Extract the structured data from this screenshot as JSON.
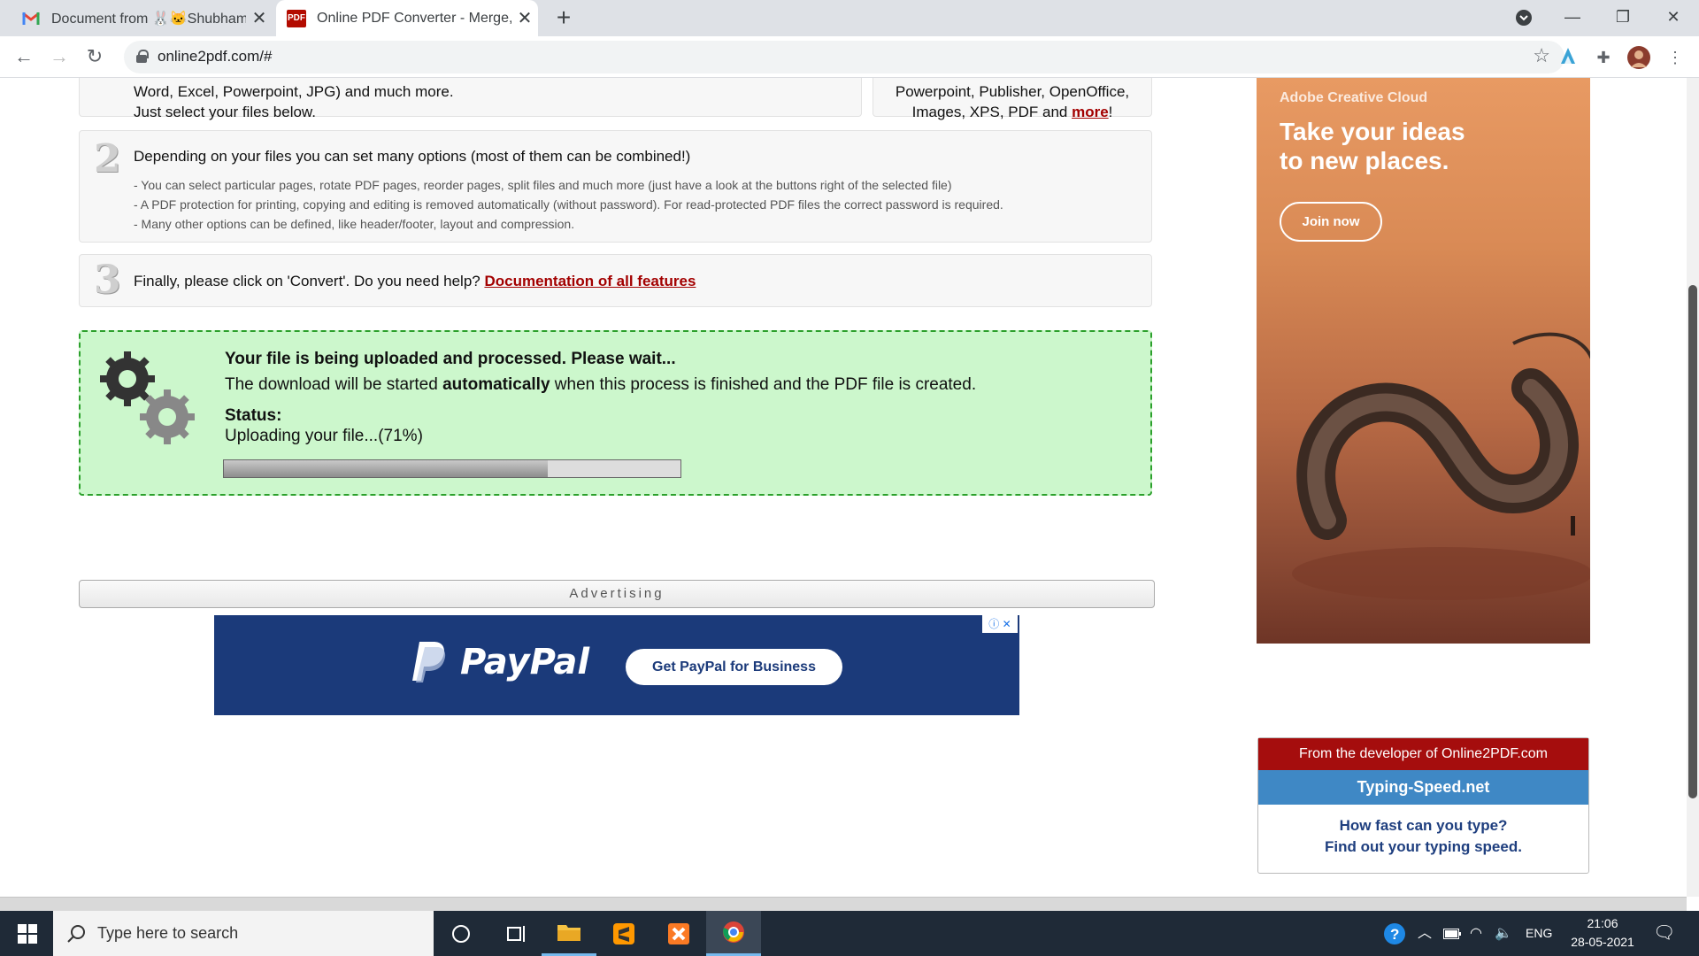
{
  "browser": {
    "tabs": [
      {
        "title": "Document from 🐰🐱Shubham🎸",
        "favicon": "gmail-icon",
        "active": false
      },
      {
        "title": "Online PDF Converter - Merge, compress",
        "favicon": "pdf-icon",
        "favicon_text": "PDF",
        "active": true
      }
    ],
    "new_tab": "+",
    "url": "online2pdf.com/#"
  },
  "steps": {
    "step1_left_line1": "Word, Excel, Powerpoint, JPG) and much more.",
    "step1_left_line2": "Just select your files below.",
    "step1_right_line1": "Powerpoint, Publisher, OpenOffice,",
    "step1_right_line2_prefix": "Images, XPS, PDF and ",
    "step1_right_link": "more",
    "step1_right_suffix": "!",
    "step2_num": "2",
    "step2_title": "Depending on your files you can set many options (most of them can be combined!)",
    "step2_bullets": [
      "- You can select particular pages, rotate PDF pages, reorder pages, split files and much more (just have a look at the buttons right of the selected file)",
      "- A PDF protection for printing, copying and editing is removed automatically (without password). For read-protected PDF files the correct password is required.",
      "- Many other options can be defined, like header/footer, layout and compression."
    ],
    "step3_num": "3",
    "step3_text": "Finally, please click on 'Convert'. Do you need help? ",
    "step3_link": "Documentation of all features"
  },
  "upload": {
    "headline": "Your file is being uploaded and processed. Please wait...",
    "desc_prefix": "The download will be started ",
    "desc_bold": "automatically",
    "desc_suffix": " when this process is finished and the PDF file is created.",
    "status_label": "Status:",
    "status_text": "Uploading your file...(71%)",
    "progress_fraction": 0.71
  },
  "ads": {
    "advertising_label": "Advertising",
    "paypal_logo": "PayPal",
    "paypal_cta": "Get PayPal for Business",
    "adobe_brand": "Adobe Creative Cloud",
    "adobe_head_line1": "Take your ideas",
    "adobe_head_line2": "to new places.",
    "adobe_cta": "Join now"
  },
  "developer": {
    "header": "From the developer of Online2PDF.com",
    "site": "Typing-Speed.net",
    "line1": "How fast can you type?",
    "line2": "Find out your typing speed."
  },
  "taskbar": {
    "search_placeholder": "Type here to search",
    "language": "ENG",
    "time": "21:06",
    "date": "28-05-2021"
  },
  "colors": {
    "green_box": "#ccf7cc",
    "green_border": "#2ca02c",
    "dark_red": "#a30000",
    "header_red": "#a50d0d",
    "typing_blue": "#3f88c5",
    "paypal_blue": "#1b3a7a"
  }
}
